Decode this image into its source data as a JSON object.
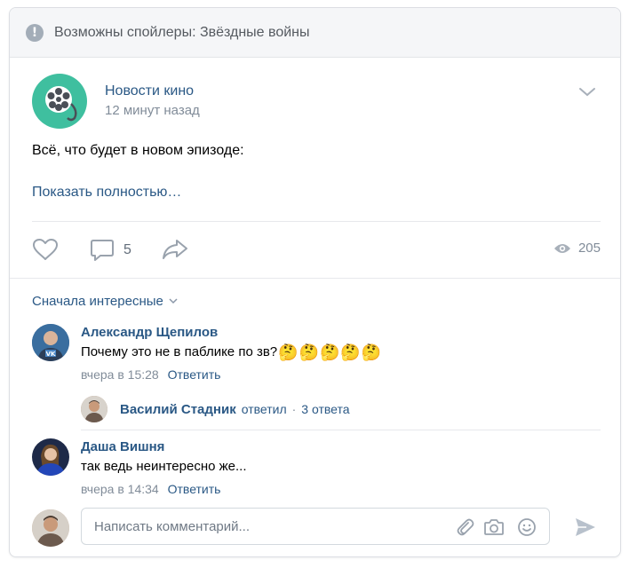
{
  "banner": {
    "text": "Возможны спойлеры: Звёздные войны",
    "icon": "exclamation-icon"
  },
  "post": {
    "author": "Новости кино",
    "time": "12 минут назад",
    "text": "Всё, что будет в новом эпизоде:",
    "show_more": "Показать полностью…",
    "comments_count": "5",
    "views_count": "205"
  },
  "comments": {
    "sort_label": "Сначала интересные",
    "items": [
      {
        "author": "Александр Щепилов",
        "text": "Почему это не в паблике по зв?",
        "emoji": "🤔🤔🤔🤔🤔",
        "time": "вчера в 15:28",
        "reply_label": "Ответить"
      },
      {
        "author": "Даша Вишня",
        "text": "так ведь неинтересно же...",
        "time": "вчера в 14:34",
        "reply_label": "Ответить"
      }
    ],
    "thread": {
      "author": "Василий Стадник",
      "action": "ответил",
      "separator": "·",
      "count": "3 ответа"
    }
  },
  "composer": {
    "placeholder": "Написать комментарий..."
  },
  "colors": {
    "link": "#2a5885",
    "muted": "#818c99",
    "avatar_main": "#3fbf9f",
    "icon": "#99a2ad"
  }
}
